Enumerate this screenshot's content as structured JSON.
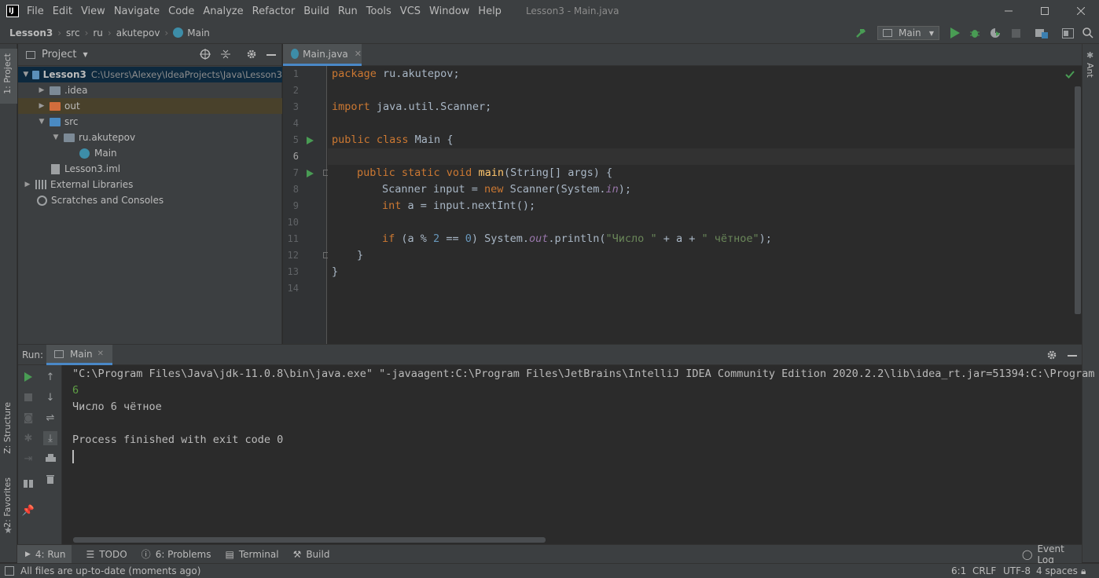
{
  "menubar": {
    "logo": "IJ",
    "items": [
      "File",
      "Edit",
      "View",
      "Navigate",
      "Code",
      "Analyze",
      "Refactor",
      "Build",
      "Run",
      "Tools",
      "VCS",
      "Window",
      "Help"
    ],
    "window_title": "Lesson3 - Main.java"
  },
  "breadcrumb": [
    "Lesson3",
    "src",
    "ru",
    "akutepov",
    "Main"
  ],
  "toolbar": {
    "run_config": "Main"
  },
  "left_stripe": {
    "project": "1: Project",
    "structure": "Z: Structure",
    "favorites": "2: Favorites"
  },
  "right_stripe": {
    "ant": "Ant"
  },
  "project_panel": {
    "title": "Project",
    "tree": [
      {
        "label": "Lesson3",
        "hint": "C:\\Users\\Alexey\\IdeaProjects\\Java\\Lesson3"
      },
      {
        "label": ".idea"
      },
      {
        "label": "out"
      },
      {
        "label": "src"
      },
      {
        "label": "ru.akutepov"
      },
      {
        "label": "Main"
      },
      {
        "label": "Lesson3.iml"
      },
      {
        "label": "External Libraries"
      },
      {
        "label": "Scratches and Consoles"
      }
    ]
  },
  "editor": {
    "tab": "Main.java",
    "line_numbers": [
      "1",
      "2",
      "3",
      "4",
      "5",
      "6",
      "7",
      "8",
      "9",
      "10",
      "11",
      "12",
      "13",
      "14"
    ],
    "code": {
      "l1_kw": "package",
      "l1_rest": " ru.akutepov;",
      "l3_kw": "import",
      "l3_rest": " java.util.Scanner;",
      "l5_kw": "public class",
      "l5_rest": " Main {",
      "l7_kw": "public static void",
      "l7_fn": "main",
      "l7_rest": "(String[] args) {",
      "l8_a": "Scanner input = ",
      "l8_kw": "new",
      "l8_b": " Scanner(System.",
      "l8_st": "in",
      "l8_c": ");",
      "l9_kw": "int",
      "l9_rest": " a = input.nextInt();",
      "l11_kw": "if",
      "l11_a": " (a % ",
      "l11_n1": "2",
      "l11_b": " == ",
      "l11_n2": "0",
      "l11_c": ") System.",
      "l11_st": "out",
      "l11_d": ".println(",
      "l11_s1": "\"Число \"",
      "l11_e": " + a + ",
      "l11_s2": "\" чётное\"",
      "l11_f": ");",
      "l12": "}",
      "l13": "}"
    }
  },
  "run": {
    "label": "Run:",
    "tab": "Main",
    "console": [
      "\"C:\\Program Files\\Java\\jdk-11.0.8\\bin\\java.exe\" \"-javaagent:C:\\Program Files\\JetBrains\\IntelliJ IDEA Community Edition 2020.2.2\\lib\\idea_rt.jar=51394:C:\\Program",
      "6",
      "Число 6 чётное",
      "",
      "Process finished with exit code 0"
    ]
  },
  "bottom_tabs": [
    {
      "label": "4: Run"
    },
    {
      "label": "TODO"
    },
    {
      "label": "6: Problems"
    },
    {
      "label": "Terminal"
    },
    {
      "label": "Build"
    }
  ],
  "event_log": "Event Log",
  "status": {
    "message": "All files are up-to-date (moments ago)",
    "position": "6:1",
    "line_sep": "CRLF",
    "encoding": "UTF-8",
    "indent": "4 spaces"
  },
  "colors": {
    "accent": "#4a88c7",
    "run_green": "#499c54",
    "keyword": "#cc7832",
    "string": "#6a8759"
  }
}
